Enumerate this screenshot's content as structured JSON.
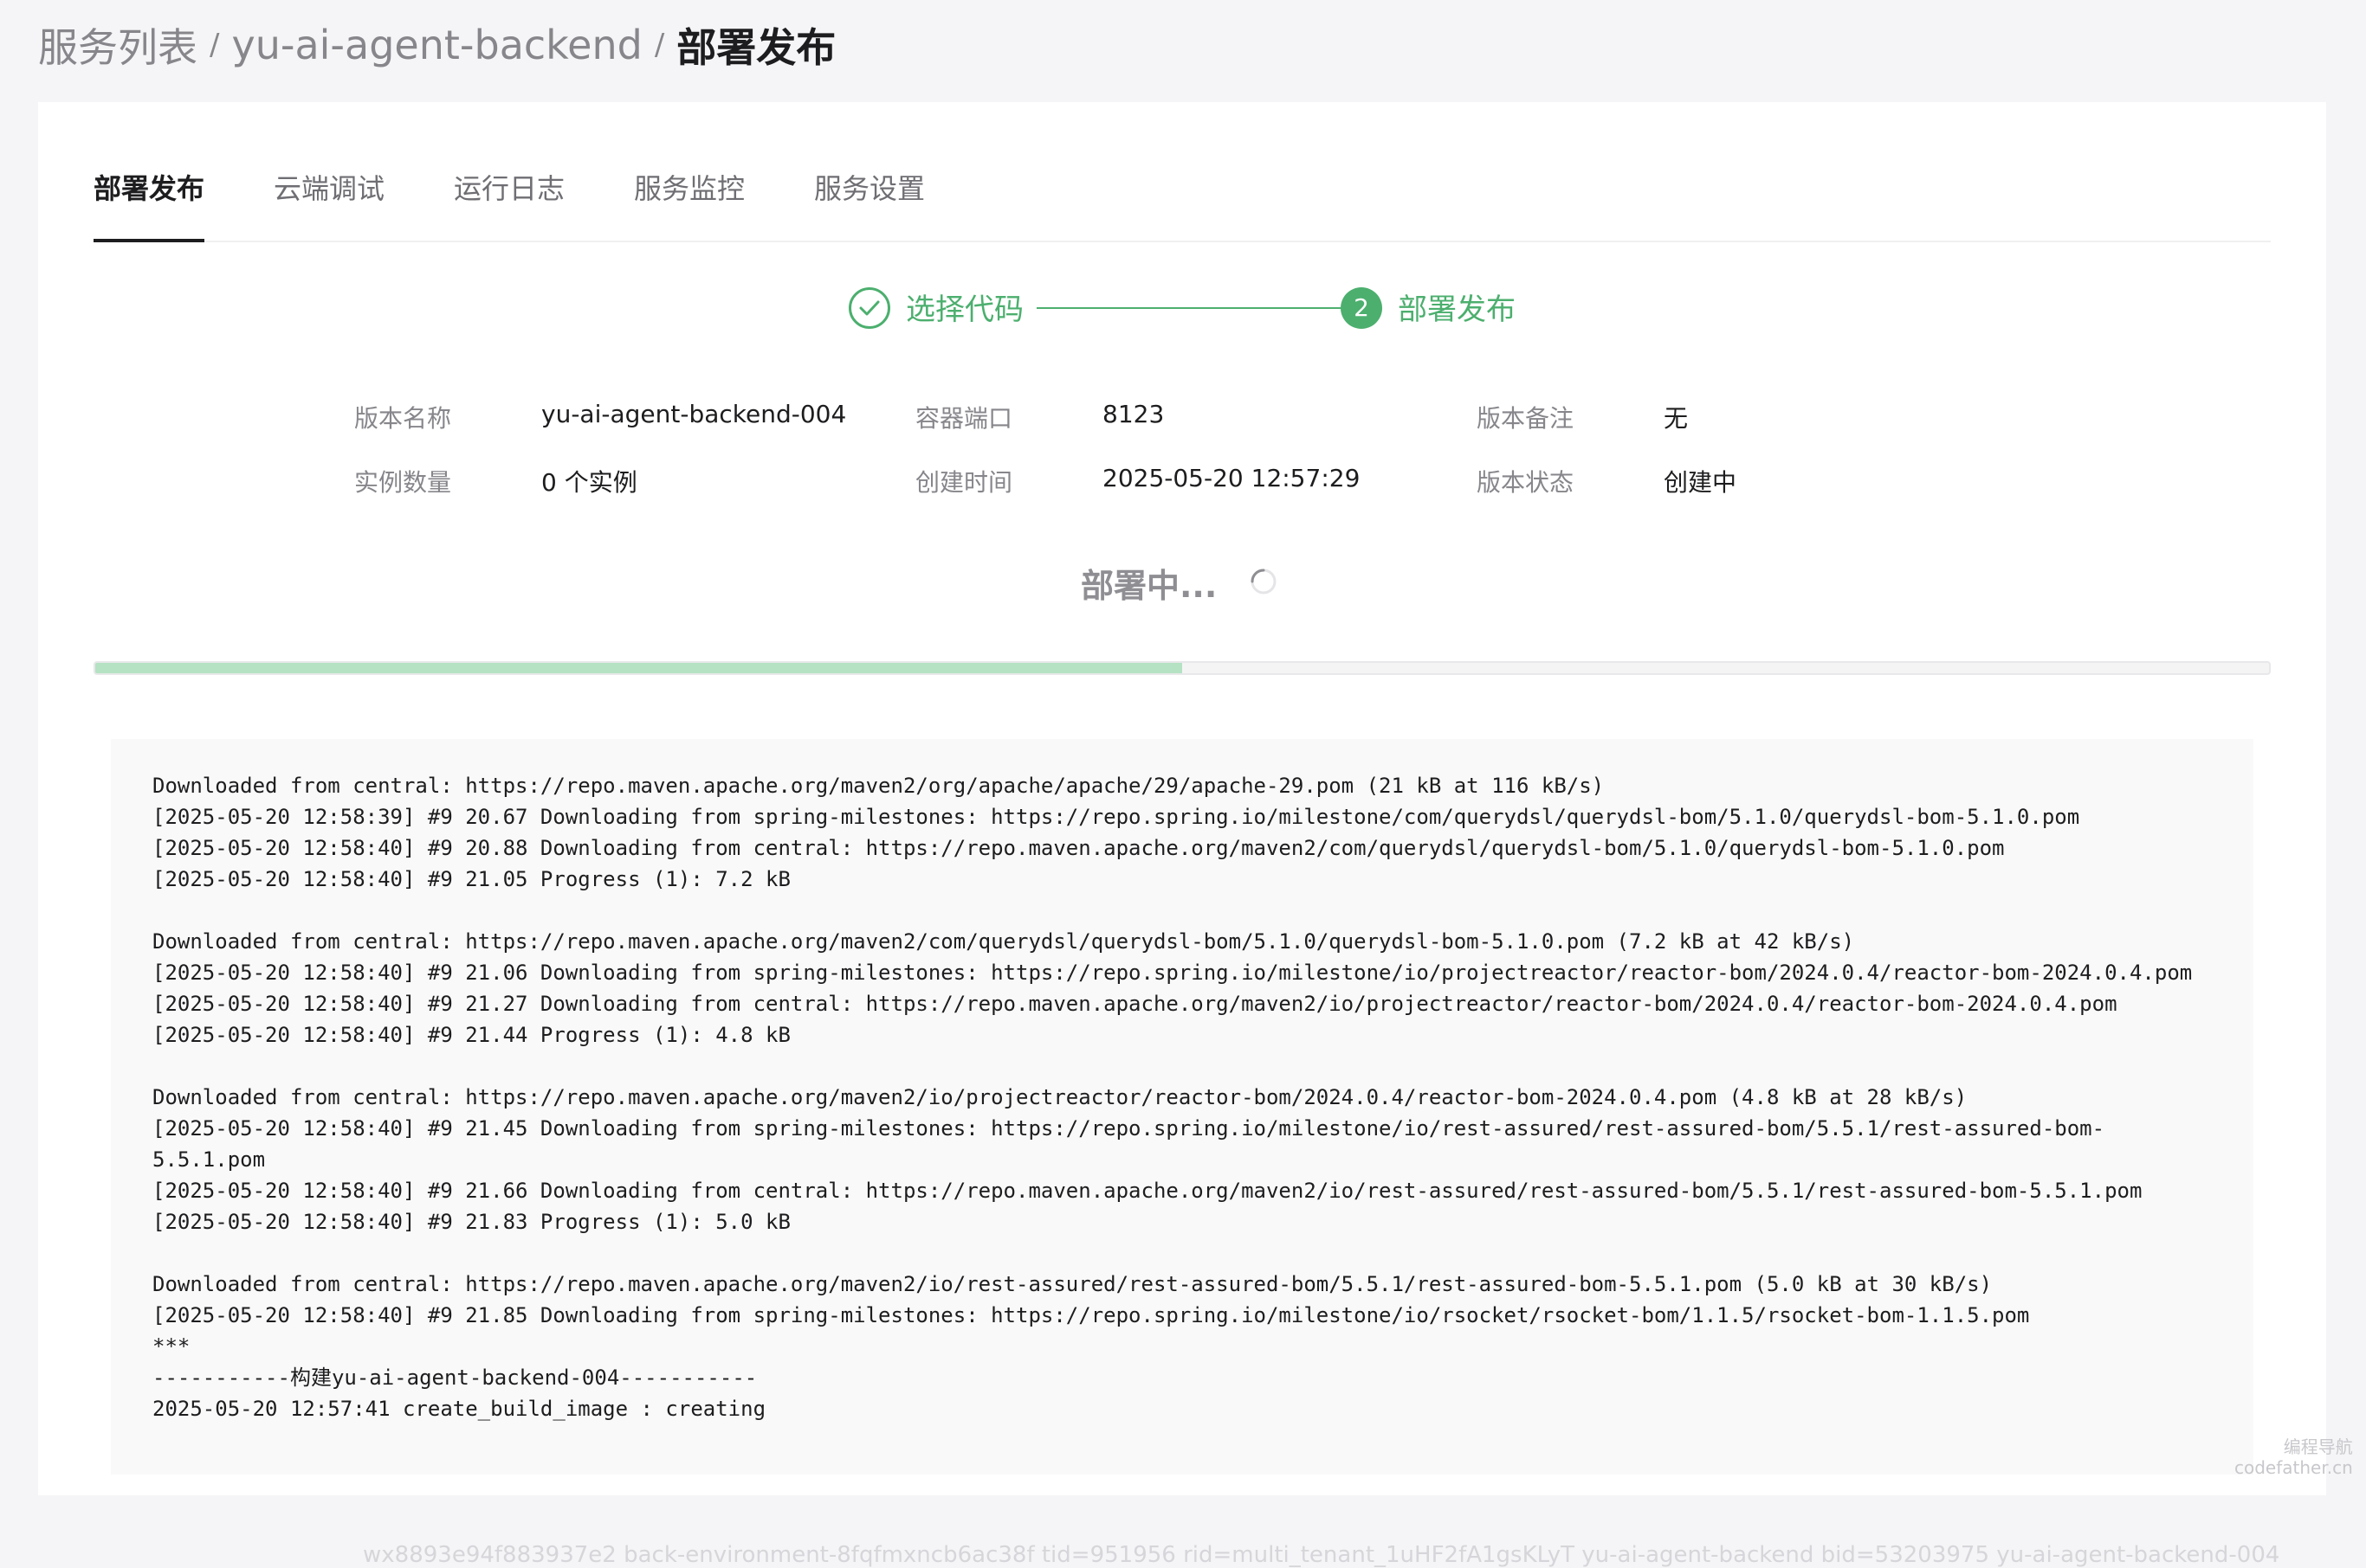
{
  "breadcrumb": {
    "items": [
      "服务列表",
      "yu-ai-agent-backend"
    ],
    "separator": "/",
    "current": "部署发布"
  },
  "tabs": [
    {
      "label": "部署发布",
      "active": true
    },
    {
      "label": "云端调试",
      "active": false
    },
    {
      "label": "运行日志",
      "active": false
    },
    {
      "label": "服务监控",
      "active": false
    },
    {
      "label": "服务设置",
      "active": false
    }
  ],
  "steps": [
    {
      "label": "选择代码",
      "status": "done",
      "icon": "check-icon"
    },
    {
      "number": "2",
      "label": "部署发布",
      "status": "active"
    }
  ],
  "info": {
    "version_name": {
      "label": "版本名称",
      "value": "yu-ai-agent-backend-004"
    },
    "container_port": {
      "label": "容器端口",
      "value": "8123"
    },
    "version_note": {
      "label": "版本备注",
      "value": "无"
    },
    "instance_count": {
      "label": "实例数量",
      "value": "0 个实例"
    },
    "created_time": {
      "label": "创建时间",
      "value": "2025-05-20 12:57:29"
    },
    "version_status": {
      "label": "版本状态",
      "value": "创建中"
    }
  },
  "deploy_status": "部署中...",
  "progress": {
    "fraction": 0.5,
    "color": "#b5e2c3"
  },
  "log_lines": [
    "Downloaded from central: https://repo.maven.apache.org/maven2/org/apache/apache/29/apache-29.pom (21 kB at 116 kB/s)",
    "[2025-05-20 12:58:39] #9 20.67 Downloading from spring-milestones: https://repo.spring.io/milestone/com/querydsl/querydsl-bom/5.1.0/querydsl-bom-5.1.0.pom",
    "[2025-05-20 12:58:40] #9 20.88 Downloading from central: https://repo.maven.apache.org/maven2/com/querydsl/querydsl-bom/5.1.0/querydsl-bom-5.1.0.pom",
    "[2025-05-20 12:58:40] #9 21.05 Progress (1): 7.2 kB",
    "",
    "Downloaded from central: https://repo.maven.apache.org/maven2/com/querydsl/querydsl-bom/5.1.0/querydsl-bom-5.1.0.pom (7.2 kB at 42 kB/s)",
    "[2025-05-20 12:58:40] #9 21.06 Downloading from spring-milestones: https://repo.spring.io/milestone/io/projectreactor/reactor-bom/2024.0.4/reactor-bom-2024.0.4.pom",
    "[2025-05-20 12:58:40] #9 21.27 Downloading from central: https://repo.maven.apache.org/maven2/io/projectreactor/reactor-bom/2024.0.4/reactor-bom-2024.0.4.pom",
    "[2025-05-20 12:58:40] #9 21.44 Progress (1): 4.8 kB",
    "",
    "Downloaded from central: https://repo.maven.apache.org/maven2/io/projectreactor/reactor-bom/2024.0.4/reactor-bom-2024.0.4.pom (4.8 kB at 28 kB/s)",
    "[2025-05-20 12:58:40] #9 21.45 Downloading from spring-milestones: https://repo.spring.io/milestone/io/rest-assured/rest-assured-bom/5.5.1/rest-assured-bom-",
    "5.5.1.pom",
    "[2025-05-20 12:58:40] #9 21.66 Downloading from central: https://repo.maven.apache.org/maven2/io/rest-assured/rest-assured-bom/5.5.1/rest-assured-bom-5.5.1.pom",
    "[2025-05-20 12:58:40] #9 21.83 Progress (1): 5.0 kB",
    "",
    "Downloaded from central: https://repo.maven.apache.org/maven2/io/rest-assured/rest-assured-bom/5.5.1/rest-assured-bom-5.5.1.pom (5.0 kB at 30 kB/s)",
    "[2025-05-20 12:58:40] #9 21.85 Downloading from spring-milestones: https://repo.spring.io/milestone/io/rsocket/rsocket-bom/1.1.5/rsocket-bom-1.1.5.pom",
    "***",
    "-----------构建yu-ai-agent-backend-004-----------",
    "2025-05-20 12:57:41 create_build_image : creating"
  ],
  "footer_meta": "wx8893e94f883937e2 back-environment-8fqfmxncb6ac38f tid=951956 rid=multi_tenant_1uHF2fA1gsKLyT yu-ai-agent-backend bid=53203975 yu-ai-agent-backend-004",
  "watermark": {
    "line1": "编程导航",
    "line2": "codefather.cn"
  },
  "colors": {
    "accent": "#4caf6e",
    "text": "#1d1d1f",
    "muted": "#86868b"
  }
}
